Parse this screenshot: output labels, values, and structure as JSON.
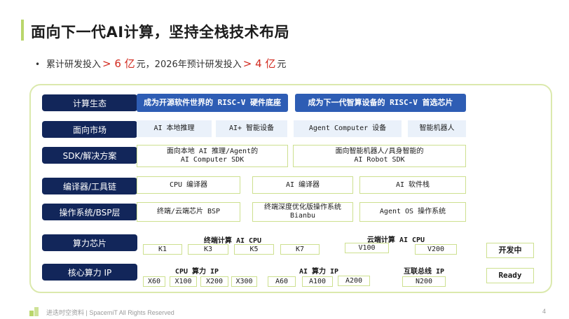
{
  "title": "面向下一代AI计算，坚持全栈技术布局",
  "bullet": {
    "dot": "•",
    "pre": "累计研发投入",
    "hl1": "> 6 亿",
    "mid": "元，2026年预计研发投入",
    "hl2": "> 4 亿",
    "post": "元"
  },
  "rows": {
    "ecosystem": "计算生态",
    "market": "面向市场",
    "sdk": "SDK/解决方案",
    "compiler": "编译器/工具链",
    "os": "操作系统/BSP层",
    "chip": "算力芯片",
    "ip": "核心算力 IP"
  },
  "ecosystem": {
    "left": "成为开源软件世界的 RISC-V 硬件底座",
    "right": "成为下一代智算设备的 RISC-V 首选芯片"
  },
  "market": [
    "AI 本地推理",
    "AI+ 智能设备",
    "Agent Computer 设备",
    "智能机器人"
  ],
  "sdk": {
    "left_line1": "面向本地 AI 推理/Agent的",
    "left_line2": "AI Computer SDK",
    "right_line1": "面向智能机器人/具身智能的",
    "right_line2": "AI Robot SDK"
  },
  "compiler": [
    "CPU 编译器",
    "AI 编译器",
    "AI 软件栈"
  ],
  "os": {
    "a": "终端/云端芯片 BSP",
    "b_line1": "终端深度优化版操作系统",
    "b_line2": "Bianbu",
    "c": "Agent OS 操作系统"
  },
  "chip": {
    "term_title": "终端计算 AI CPU",
    "term_items": [
      "K1",
      "K3",
      "K5",
      "K7"
    ],
    "cloud_title": "云端计算 AI CPU",
    "cloud_items": [
      "V100",
      "V200"
    ],
    "status": "开发中"
  },
  "ip": {
    "cpu_title": "CPU 算力 IP",
    "cpu_items": [
      "X60",
      "X100",
      "X200",
      "X300"
    ],
    "ai_title": "AI 算力 IP",
    "ai_items": [
      "A60",
      "A100",
      "A200"
    ],
    "bus_title": "互联总线 IP",
    "bus_items": [
      "N200"
    ],
    "status": "Ready"
  },
  "footer": "进迭时空资料 | SpacemiT All Rights Reserved",
  "page_number": "4",
  "colors": {
    "navy": "#12265a",
    "blue": "#2e5db4",
    "lime": "#cde08f",
    "accent_red": "#d22a1f"
  }
}
